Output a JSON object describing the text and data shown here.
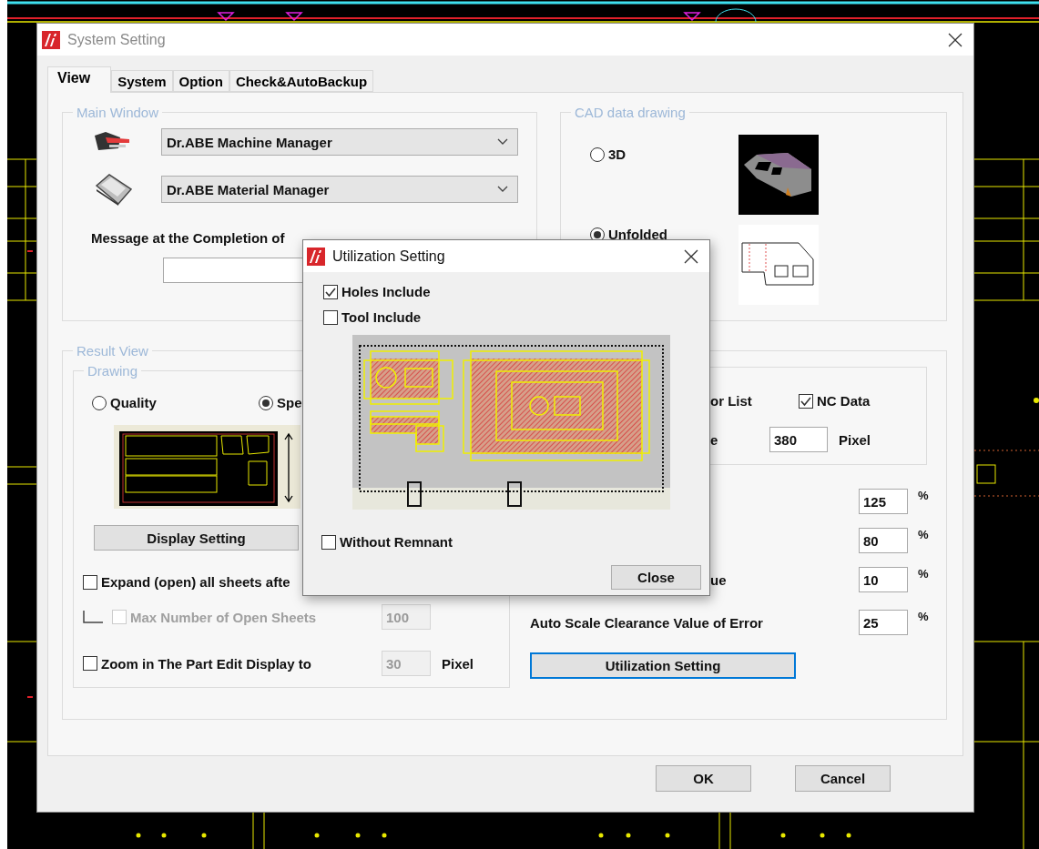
{
  "window": {
    "title": "System Setting"
  },
  "tabs": [
    {
      "label": "View",
      "selected": true
    },
    {
      "label": "System",
      "selected": false
    },
    {
      "label": "Option",
      "selected": false
    },
    {
      "label": "Check&AutoBackup",
      "selected": false
    }
  ],
  "main_window": {
    "legend": "Main Window",
    "managers": [
      {
        "value": "Dr.ABE Machine Manager"
      },
      {
        "value": "Dr.ABE Material Manager"
      }
    ],
    "message_label": "Message at the Completion of"
  },
  "cad_data_drawing": {
    "legend": "CAD data drawing",
    "options": [
      {
        "label": "3D",
        "selected": false
      },
      {
        "label": "Unfolded",
        "selected": true
      }
    ]
  },
  "result_view": {
    "legend": "Result View",
    "drawing": {
      "legend": "Drawing",
      "options": [
        {
          "label": "Quality",
          "selected": false
        },
        {
          "label": "Spe",
          "selected": true
        }
      ],
      "display_setting": "Display Setting",
      "expand": {
        "label": "Expand (open) all sheets afte",
        "checked": false,
        "disabled": false,
        "children": [
          {
            "label": "Max Number of Open Sheets",
            "checked": false,
            "disabled": true,
            "value": "100"
          }
        ]
      },
      "zoom": {
        "label": "Zoom in The Part Edit Display to",
        "checked": false,
        "disabled": false,
        "value": "30",
        "unit": "Pixel"
      }
    },
    "output": {
      "list_label": "or List",
      "nc_data": {
        "label": "NC Data",
        "checked": true
      },
      "size_label": "e",
      "size_value": "380",
      "size_unit": "Pixel"
    },
    "rates": [
      {
        "value": "125",
        "unit": "%"
      },
      {
        "value": "80",
        "unit": "%"
      },
      {
        "label": "ue",
        "value": "10",
        "unit": "%"
      },
      {
        "label": "Auto Scale Clearance Value of Error",
        "value": "25",
        "unit": "%"
      }
    ],
    "utilization_button": {
      "label": "Utilization Setting",
      "focused": true
    }
  },
  "buttons": [
    {
      "label": "OK"
    },
    {
      "label": "Cancel"
    }
  ],
  "utilization_dialog": {
    "title": "Utilization Setting",
    "options": [
      {
        "label": "Holes Include",
        "checked": true
      },
      {
        "label": "Tool Include",
        "checked": false
      }
    ],
    "without_remnant": {
      "label": "Without Remnant",
      "checked": false
    },
    "close": "Close"
  }
}
